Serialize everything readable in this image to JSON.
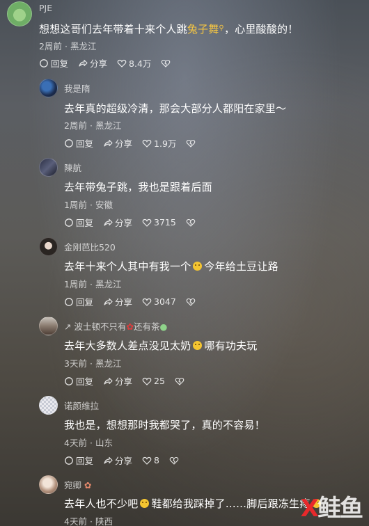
{
  "comments": [
    {
      "user": "PJE",
      "text_a": "想想这哥们去年带着十来个人跳",
      "text_hl": "兔子舞",
      "text_b": "，心里酸酸的！",
      "time": "2周前",
      "location": "黑龙江",
      "reply": "回复",
      "share": "分享",
      "likes": "8.4万"
    },
    {
      "user": "我是隋",
      "text": "去年真的超级冷清，那会大部分人都阳在家里～",
      "time": "2周前",
      "location": "黑龙江",
      "reply": "回复",
      "share": "分享",
      "likes": "1.9万"
    },
    {
      "user": "陳航",
      "text": "去年带兔子跳，我也是跟着后面",
      "time": "1周前",
      "location": "安徽",
      "reply": "回复",
      "share": "分享",
      "likes": "3715"
    },
    {
      "user": "金刚芭比520",
      "text_a": "去年十来个人其中有我一个",
      "text_b": "今年给土豆让路",
      "time": "1周前",
      "location": "黑龙江",
      "reply": "回复",
      "share": "分享",
      "likes": "3047"
    },
    {
      "user_a": "波士顿不只有",
      "user_b": "还有茶",
      "text_a": "去年大多数人差点没见太奶",
      "text_b": "哪有功夫玩",
      "time": "3天前",
      "location": "黑龙江",
      "reply": "回复",
      "share": "分享",
      "likes": "25"
    },
    {
      "user": "诺颜维拉",
      "text": "我也是，想想那时我都哭了，真的不容易！",
      "time": "4天前",
      "location": "山东",
      "reply": "回复",
      "share": "分享",
      "likes": "8"
    },
    {
      "user": "宛卿",
      "text_a": "去年人也不少吧",
      "text_b": "鞋都给我踩掉了……脚后跟冻生疼",
      "time": "4天前",
      "location": "陕西"
    }
  ],
  "watermark": {
    "x": "X",
    "rest": "鲑鱼"
  },
  "colors": {
    "highlight": "#f5c542",
    "watermark_red": "#e8292b"
  }
}
